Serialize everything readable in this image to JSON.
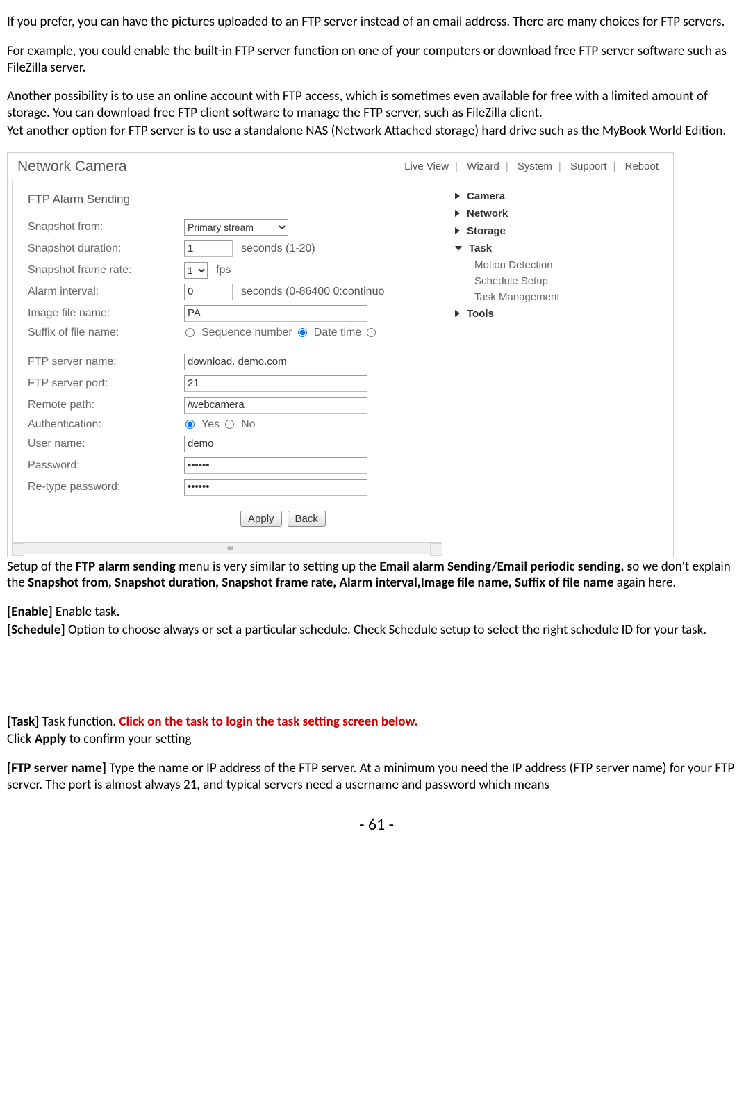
{
  "intro": {
    "p1": "If you prefer, you can have the pictures uploaded to an FTP server instead of an email address. There are many choices for FTP servers.",
    "p2": "For example, you could enable the built-in FTP server function on one of your computers or download free FTP server software such as FileZilla server.",
    "p3": "Another possibility is to use an online account with FTP access, which is sometimes even available for free with a limited amount of storage. You can download free FTP client software to manage the FTP server, such as FileZilla client.",
    "p4": "Yet another option for FTP server is to use a standalone NAS (Network Attached storage) hard drive such as the MyBook World Edition."
  },
  "shot": {
    "title": "Network Camera",
    "tabs": [
      "Live View",
      "Wizard",
      "System",
      "Support",
      "Reboot"
    ],
    "panel_title": "FTP Alarm Sending",
    "labels": {
      "snapshot_from": "Snapshot from:",
      "snapshot_duration": "Snapshot duration:",
      "snapshot_frame": "Snapshot frame rate:",
      "alarm_interval": "Alarm interval:",
      "image_file_name": "Image file name:",
      "suffix": "Suffix of file name:",
      "ftp_server_name": "FTP server name:",
      "ftp_server_port": "FTP server port:",
      "remote_path": "Remote path:",
      "authentication": "Authentication:",
      "user_name": "User name:",
      "password": "Password:",
      "retype_password": "Re-type password:"
    },
    "values": {
      "snapshot_from": "Primary stream",
      "snapshot_duration": "1",
      "snapshot_duration_unit": "seconds (1-20)",
      "snapshot_frame": "1",
      "snapshot_frame_unit": "fps",
      "alarm_interval": "0",
      "alarm_interval_unit": "seconds (0-86400 0:continuo",
      "image_file_name": "PA",
      "suffix_seq": "Sequence number",
      "suffix_date": "Date time",
      "ftp_server_name": "download. demo.com",
      "ftp_server_port": "21",
      "remote_path": "/webcamera",
      "auth_yes": "Yes",
      "auth_no": "No",
      "user_name": "demo",
      "password": "••••••",
      "retype_password": "••••••"
    },
    "buttons": {
      "apply": "Apply",
      "back": "Back"
    },
    "tree": {
      "camera": "Camera",
      "network": "Network",
      "storage": "Storage",
      "task": "Task",
      "task_children": [
        "Motion Detection",
        "Schedule Setup",
        "Task Management"
      ],
      "tools": "Tools"
    }
  },
  "after": {
    "setup_line_a": "Setup of the ",
    "setup_bold1": "FTP alarm sending",
    "setup_line_b": " menu is very similar to setting up the ",
    "setup_bold2": "Email alarm Sending/Email periodic sending, s",
    "setup_line_c": "o we don't explain the ",
    "setup_bold3": "Snapshot from, Snapshot duration, Snapshot frame rate, Alarm interval,Image file name, Suffix of file name",
    "setup_line_d": " again here.",
    "enable_label": "[Enable]",
    "enable_text": " Enable task.",
    "schedule_label": "[Schedule]",
    "schedule_text": " Option to choose always or set a particular schedule. Check Schedule setup to select the right schedule ID for your task.",
    "task_label": "[Task]",
    "task_text_a": " Task function. ",
    "task_red": "Click on the task to login the task setting screen below.",
    "click_apply_a": "Click ",
    "click_apply_b": "Apply",
    "click_apply_c": " to confirm your setting",
    "ftp_name_label": "[FTP server name]",
    "ftp_name_text": " Type the name or IP address of the FTP server. At a minimum you need the IP address (FTP server name) for your FTP server. The port is almost always 21, and typical servers need a username and password which means"
  },
  "page_number": "- 61 -"
}
